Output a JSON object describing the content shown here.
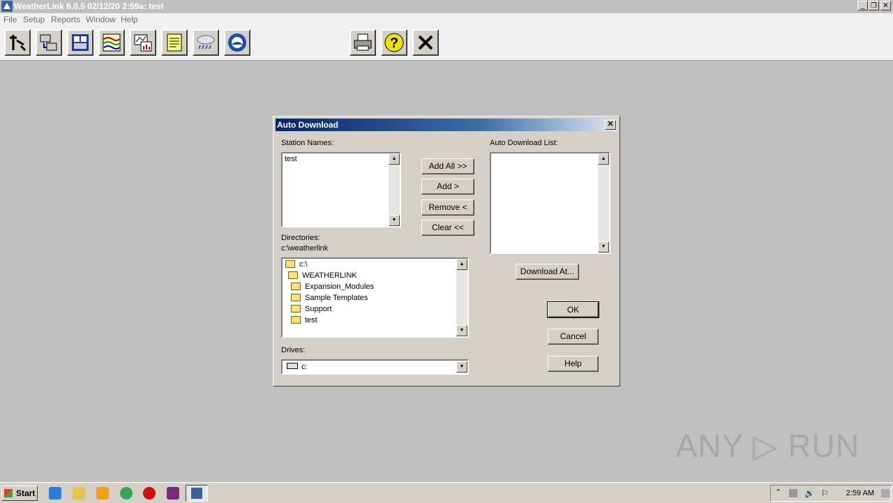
{
  "app": {
    "title": "WeatherLink 6.0.5  02/12/20   2:59a: test"
  },
  "window_controls": {
    "minimize": "_",
    "restore": "❐",
    "close": "✕"
  },
  "menu": [
    "File",
    "Setup",
    "Reports",
    "Window",
    "Help"
  ],
  "toolbar": {
    "buttons": [
      "select-station-icon",
      "connect-icon",
      "bulletin-icon",
      "plot-icon",
      "summary-icon",
      "notes-icon",
      "weather-icon",
      "noaa-icon"
    ],
    "right_buttons": [
      "print-icon",
      "help-icon",
      "exit-icon"
    ]
  },
  "dialog": {
    "title": "Auto Download",
    "close": "✕",
    "station_names_label": "Station Names:",
    "station_names": [
      "test"
    ],
    "add_all_label": "Add All >>",
    "add_label": "Add >",
    "remove_label": "Remove <",
    "clear_label": "Clear <<",
    "auto_list_label": "Auto Download List:",
    "auto_list": [],
    "download_at_label": "Download At...",
    "directories_label": "Directories:",
    "current_dir": "c:\\weatherlink",
    "tree": [
      "c:\\",
      "WEATHERLINK",
      "Expansion_Modules",
      "Sample Templates",
      "Support",
      "test"
    ],
    "drives_label": "Drives:",
    "drive_value": "c:",
    "ok_label": "OK",
    "cancel_label": "Cancel",
    "help_label": "Help"
  },
  "watermark": "ANY ▷ RUN",
  "taskbar": {
    "start_label": "Start",
    "clock": "2:59 AM"
  }
}
